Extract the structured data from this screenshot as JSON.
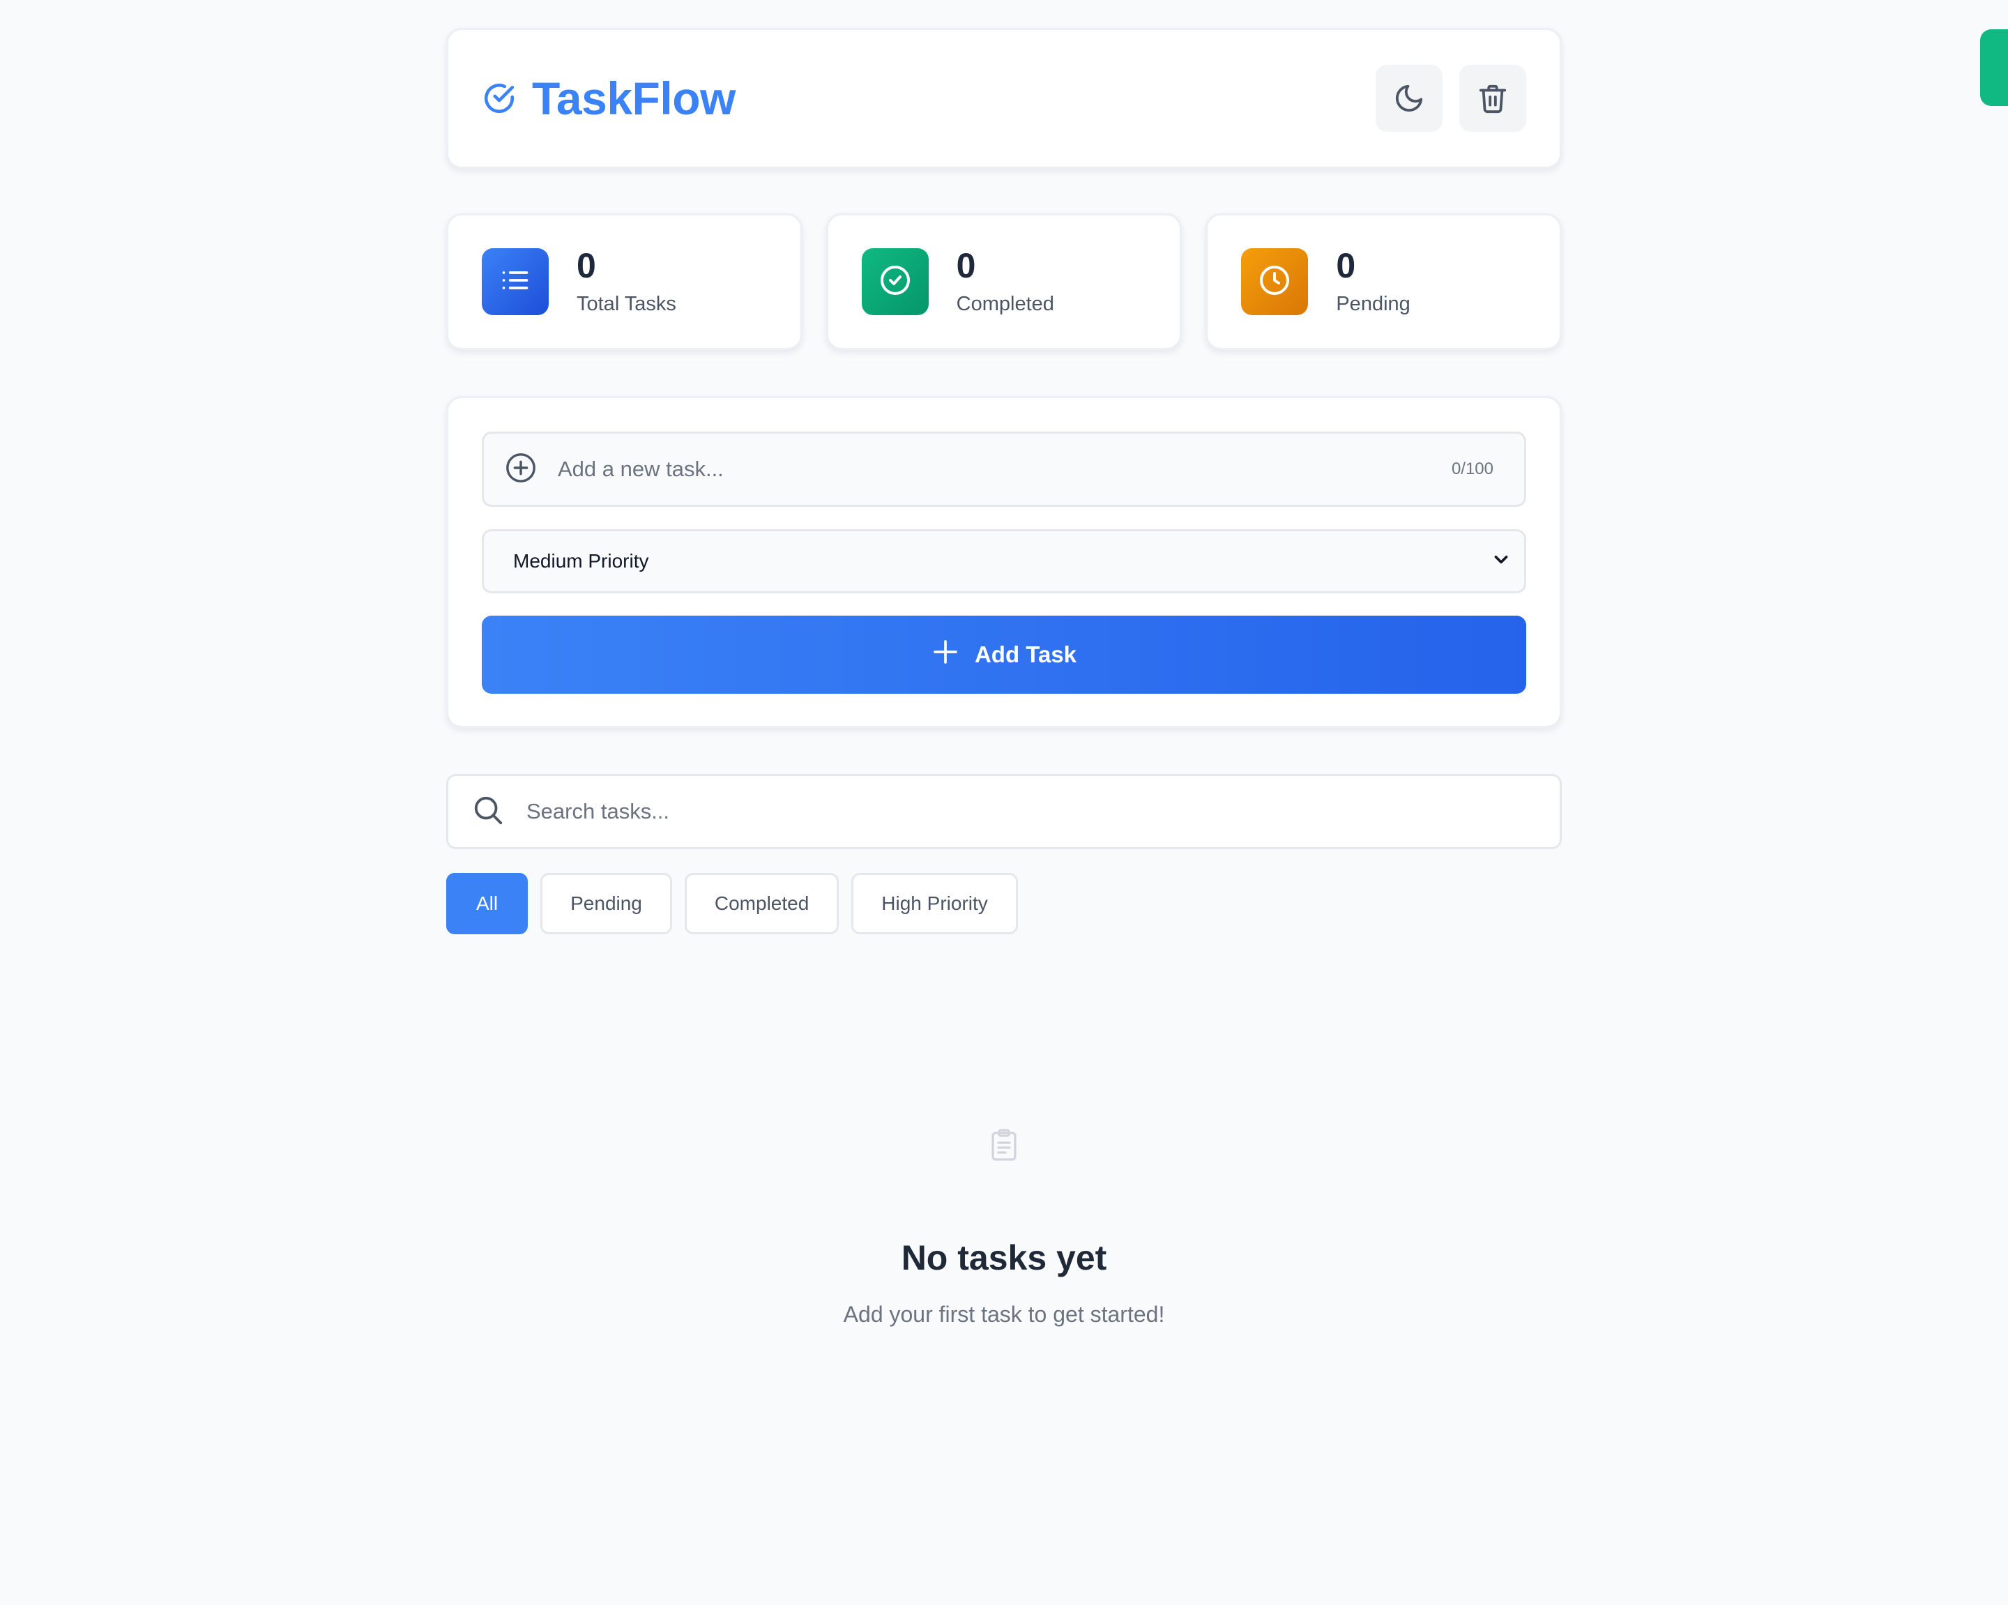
{
  "header": {
    "title": "TaskFlow",
    "brand_icon": "check-circle-icon",
    "actions": [
      {
        "icon": "moon-icon",
        "name": "theme-toggle-button"
      },
      {
        "icon": "trash-icon",
        "name": "clear-all-button"
      }
    ]
  },
  "stats": [
    {
      "value": "0",
      "label": "Total Tasks",
      "icon": "list-icon",
      "color": "#3b82f6"
    },
    {
      "value": "0",
      "label": "Completed",
      "icon": "check-circle-icon",
      "color": "#10b981"
    },
    {
      "value": "0",
      "label": "Pending",
      "icon": "clock-icon",
      "color": "#f59e0b"
    }
  ],
  "form": {
    "task_placeholder": "Add a new task...",
    "counter": "0/100",
    "priority_selected": "Medium Priority",
    "add_button_label": "Add Task"
  },
  "search": {
    "placeholder": "Search tasks..."
  },
  "filters": [
    {
      "label": "All",
      "active": true
    },
    {
      "label": "Pending",
      "active": false
    },
    {
      "label": "Completed",
      "active": false
    },
    {
      "label": "High Priority",
      "active": false
    }
  ],
  "empty_state": {
    "icon": "clipboard-icon",
    "title": "No tasks yet",
    "subtitle": "Add your first task to get started!"
  },
  "colors": {
    "accent": "#3b82f6",
    "success": "#10b981",
    "warning": "#f59e0b",
    "background": "#f8fafc"
  }
}
